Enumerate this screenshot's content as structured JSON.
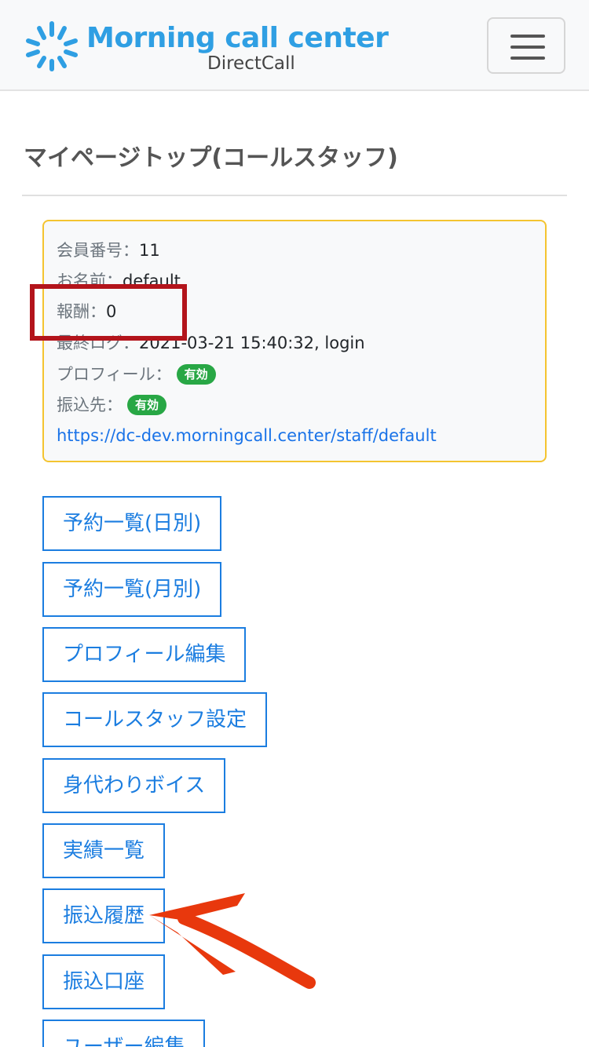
{
  "brand": {
    "name": "Morning call center",
    "sub": "DirectCall",
    "accent": "#2f9fe3"
  },
  "nav": {
    "toggler_icon": "hamburger-icon"
  },
  "page": {
    "title": "マイページトップ(コールスタッフ)"
  },
  "info": {
    "member_no_label": "会員番号：",
    "member_no": "11",
    "name_label": "お名前：",
    "name": "default",
    "reward_label": "報酬：",
    "reward": "0",
    "last_log_label": "最終ログ：",
    "last_log": "2021-03-21 15:40:32, login",
    "profile_label": "プロフィール：",
    "profile_status": "有効",
    "bank_label": "振込先：",
    "bank_status": "有効",
    "url": "https://dc-dev.morningcall.center/staff/default"
  },
  "buttons": [
    "予約一覧(日別)",
    "予約一覧(月別)",
    "プロフィール編集",
    "コールスタッフ設定",
    "身代わりボイス",
    "実績一覧",
    "振込履歴",
    "振込口座",
    "ユーザー編集"
  ],
  "colors": {
    "primary": "#1b7de0",
    "success": "#28a745",
    "warning_border": "#f4c430",
    "annotation": "#b3141b",
    "arrow": "#e8380d"
  }
}
